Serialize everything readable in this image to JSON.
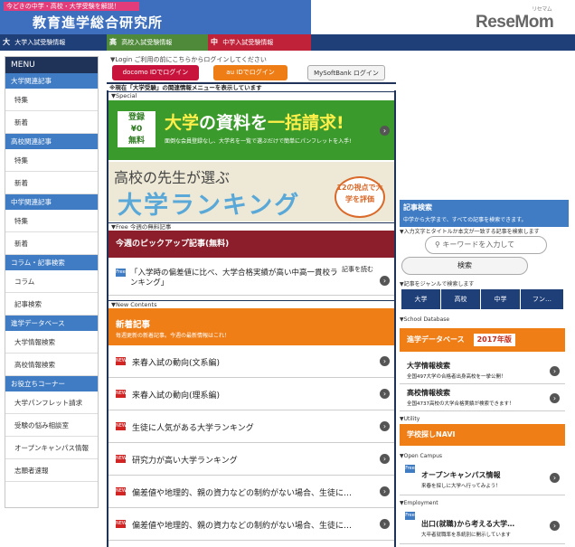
{
  "header": {
    "tagline": "今どきの中学・高校・大学受験を解説！",
    "site_title": "教育進学総合研究所"
  },
  "logo": {
    "text": "ReseMom",
    "ruby": "リセマム"
  },
  "gnav": [
    {
      "mark": "大",
      "label": "大学入試受験情報",
      "color": "#1f3f78"
    },
    {
      "mark": "高",
      "label": "高校入試受験情報",
      "color": "#4e8a3a"
    },
    {
      "mark": "中",
      "label": "中学入試受験情報",
      "color": "#c0223a"
    }
  ],
  "menu": {
    "title": "MENU",
    "sections": [
      {
        "label": "大学関連記事",
        "items": [
          "特集",
          "新着"
        ]
      },
      {
        "label": "高校関連記事",
        "items": [
          "特集",
          "新着"
        ]
      },
      {
        "label": "中学関連記事",
        "items": [
          "特集",
          "新着"
        ]
      },
      {
        "label": "コラム・記事検索",
        "items": [
          "コラム",
          "記事検索"
        ]
      },
      {
        "label": "進学データベース",
        "items": [
          "大学情報検索",
          "高校情報検索"
        ]
      },
      {
        "label": "お役立ちコーナー",
        "items": [
          "大学パンフレット請求",
          "受験の悩み相談室",
          "オープンキャンパス情報",
          "志願者速報"
        ]
      }
    ]
  },
  "login": {
    "text": "▼Login ご利用の前にこちらからログインしてください",
    "docomo": "docomo IDでログイン",
    "au": "au IDでログイン",
    "softbank": "MySoftBank ログイン"
  },
  "notice": "※現在「大学受験」の関連情報メニューを表示しています",
  "labels": {
    "special": "▼Special",
    "free": "▼Free 今週の無料記事",
    "new_contents": "▼New Contents"
  },
  "banner1": {
    "free_line1": "登録",
    "free_line2": "¥0",
    "free_line3": "無料",
    "headline_a": "大学",
    "headline_b": "の資料を",
    "headline_c": "一括請求!",
    "sub": "面倒な会員登録なし、大学名を一覧で選ぶだけで簡単にパンフレットを入手!"
  },
  "banner2": {
    "line1": "高校の先生が選ぶ",
    "line2": "大学ランキング",
    "circle": "12の視点で大学を評価"
  },
  "pickup": {
    "title": "今週のピックアップ記事(無料)",
    "badge": "Free",
    "text": "「入学時の偏差値に比べ、大学合格実績が高い中高一貫校ランキング」",
    "read": "記事を読む"
  },
  "new_articles": {
    "title": "新着記事",
    "sub": "毎週更新の新着記事。今週の最新情報はこれ！",
    "badge": "NEW",
    "items": [
      "来春入試の動向(文系編)",
      "来春入試の動向(理系編)",
      "生徒に人気がある大学ランキング",
      "研究力が高い大学ランキング",
      "偏差値や地理的、親の資力などの制約がない場合、生徒に…",
      "偏差値や地理的、親の資力などの制約がない場合、生徒に…"
    ]
  },
  "search": {
    "title": "記事検索",
    "sub": "中学から大学まで、すべての記事を検索できます。",
    "note": "▼入力文字とタイトルか本文が一致する記事を検索します",
    "keyword_placeholder": "キーワードを入力して",
    "button": "検索",
    "genre_label": "▼記事をジャンルで検索します",
    "tabs": [
      "大学",
      "高校",
      "中学",
      "フン…"
    ]
  },
  "school_db": {
    "label": "▼School Database",
    "title": "進学データベース",
    "year": "2017年版",
    "entries": [
      {
        "title": "大学情報検索",
        "desc": "全国497大学の合格者出身高校を一挙公開！"
      },
      {
        "title": "高校情報検索",
        "desc": "全国4737高校の大学合格実績が検索できます！"
      }
    ]
  },
  "utility": {
    "label": "▼Utility",
    "navi": "学校探しNAVI"
  },
  "open_campus": {
    "label": "▼Open Campus",
    "badge": "Free",
    "title": "オープンキャンパス情報",
    "desc": "来春を探しに大学へ行ってみよう！"
  },
  "employment": {
    "label": "▼Employment",
    "badge": "Free",
    "title": "出口(就職)から考える大学…",
    "desc": "大卒者就職率を系統別に開示しています"
  }
}
